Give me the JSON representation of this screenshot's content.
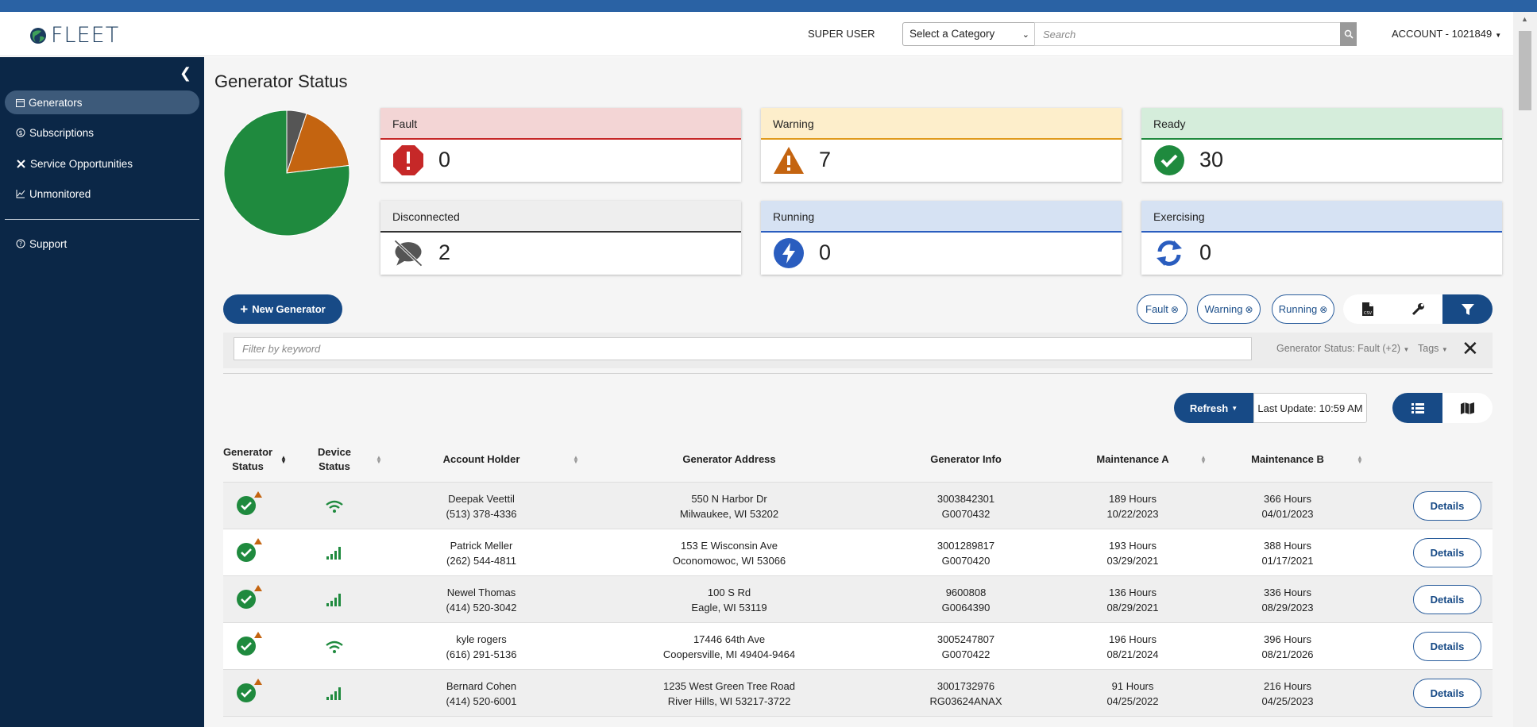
{
  "app": {
    "logo_text": "FLEET",
    "super_user": "SUPER USER",
    "category_select": "Select a Category",
    "search_placeholder": "Search",
    "account": "ACCOUNT - 1021849"
  },
  "sidebar": {
    "items": [
      {
        "label": "Generators",
        "icon": "calendar-icon"
      },
      {
        "label": "Subscriptions",
        "icon": "dollar-circle-icon"
      },
      {
        "label": "Service Opportunities",
        "icon": "tools-icon"
      },
      {
        "label": "Unmonitored",
        "icon": "line-chart-icon"
      }
    ],
    "support": {
      "label": "Support",
      "icon": "question-circle-icon"
    }
  },
  "page": {
    "title": "Generator Status"
  },
  "summary_pie": {
    "slices": [
      {
        "status": "Ready",
        "value": 30,
        "color": "#1f8a3e"
      },
      {
        "status": "Disconnected",
        "value": 2,
        "color": "#555555"
      },
      {
        "status": "Warning",
        "value": 7,
        "color": "#c46410"
      }
    ]
  },
  "cards": {
    "fault": {
      "label": "Fault",
      "value": "0",
      "color": "#c62828",
      "bg": "#f3d5d5"
    },
    "warning": {
      "label": "Warning",
      "value": "7",
      "color": "#e09a1c",
      "bg": "#fdeecb"
    },
    "ready": {
      "label": "Ready",
      "value": "30",
      "color": "#1f8a3e",
      "bg": "#d5eddb"
    },
    "disconnected": {
      "label": "Disconnected",
      "value": "2",
      "color": "#333333",
      "bg": "#eeeeee"
    },
    "running": {
      "label": "Running",
      "value": "0",
      "color": "#2a5dbf",
      "bg": "#d6e2f3"
    },
    "exercising": {
      "label": "Exercising",
      "value": "0",
      "color": "#2a5dbf",
      "bg": "#d6e2f3"
    }
  },
  "toolbar": {
    "new_generator": "New Generator",
    "chips": [
      "Fault",
      "Warning",
      "Running"
    ],
    "csv_icon": "csv-file-icon",
    "wrench_icon": "wrench-icon",
    "filter_icon": "filter-icon"
  },
  "filters": {
    "keyword_placeholder": "Filter by keyword",
    "status": "Generator Status: Fault (+2)",
    "tags": "Tags"
  },
  "refresh": {
    "label": "Refresh",
    "last_update": "Last Update: 10:59 AM"
  },
  "table": {
    "headers": {
      "status_line1": "Generator",
      "status_line2": "Status",
      "device": "Device Status",
      "holder": "Account Holder",
      "address": "Generator Address",
      "info": "Generator Info",
      "maint_a": "Maintenance A",
      "maint_b": "Maintenance B"
    },
    "details_label": "Details",
    "rows": [
      {
        "holder_name": "Deepak Veettil",
        "holder_phone": "(513) 378-4336",
        "addr1": "550 N Harbor Dr",
        "addr2": "Milwaukee, WI 53202",
        "info1": "3003842301",
        "info2": "G0070432",
        "ma_hours": "189 Hours",
        "ma_date": "10/22/2023",
        "mb_hours": "366 Hours",
        "mb_date": "04/01/2023",
        "device": "wifi"
      },
      {
        "holder_name": "Patrick Meller",
        "holder_phone": "(262) 544-4811",
        "addr1": "153 E Wisconsin Ave",
        "addr2": "Oconomowoc, WI 53066",
        "info1": "3001289817",
        "info2": "G0070420",
        "ma_hours": "193 Hours",
        "ma_date": "03/29/2021",
        "mb_hours": "388 Hours",
        "mb_date": "01/17/2021",
        "device": "cellular"
      },
      {
        "holder_name": "Newel Thomas",
        "holder_phone": "(414) 520-3042",
        "addr1": "100 S Rd",
        "addr2": "Eagle, WI 53119",
        "info1": "9600808",
        "info2": "G0064390",
        "ma_hours": "136 Hours",
        "ma_date": "08/29/2021",
        "mb_hours": "336 Hours",
        "mb_date": "08/29/2023",
        "device": "cellular"
      },
      {
        "holder_name": "kyle rogers",
        "holder_phone": "(616) 291-5136",
        "addr1": "17446 64th Ave",
        "addr2": "Coopersville, MI 49404-9464",
        "info1": "3005247807",
        "info2": "G0070422",
        "ma_hours": "196 Hours",
        "ma_date": "08/21/2024",
        "mb_hours": "396 Hours",
        "mb_date": "08/21/2026",
        "device": "wifi"
      },
      {
        "holder_name": "Bernard Cohen",
        "holder_phone": "(414) 520-6001",
        "addr1": "1235 West Green Tree Road",
        "addr2": "River Hills, WI 53217-3722",
        "info1": "3001732976",
        "info2": "RG03624ANAX",
        "ma_hours": "91 Hours",
        "ma_date": "04/25/2022",
        "mb_hours": "216 Hours",
        "mb_date": "04/25/2023",
        "device": "cellular"
      }
    ]
  }
}
